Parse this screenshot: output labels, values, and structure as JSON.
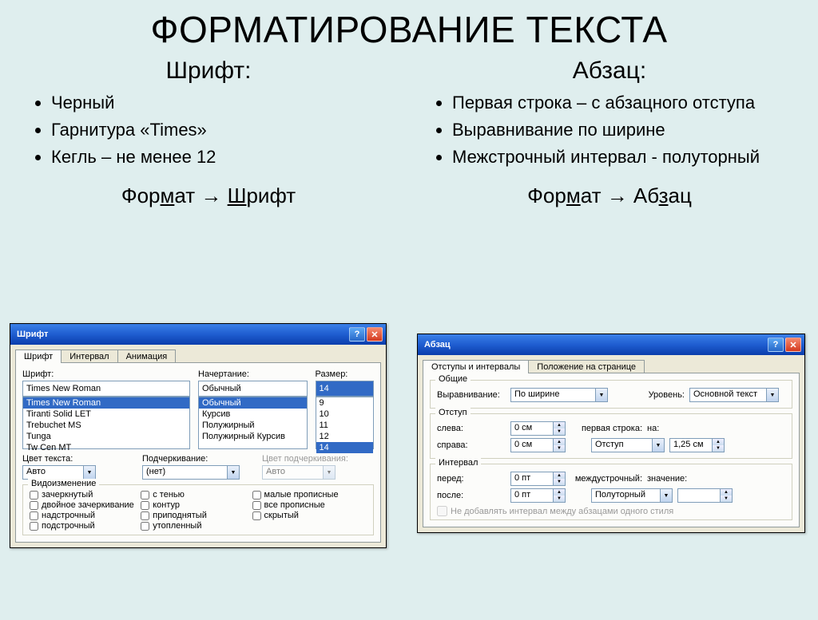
{
  "title": "ФОРМАТИРОВАНИЕ ТЕКСТА",
  "left": {
    "heading": "Шрифт:",
    "bullets": [
      "Черный",
      "Гарнитура «Times»",
      "Кегль – не менее 12"
    ],
    "path_pre": "Фор",
    "path_mid_ul": "м",
    "path_mid": "ат → ",
    "path_tail_ul": "Ш",
    "path_tail": "рифт"
  },
  "right": {
    "heading": "Абзац:",
    "bullets": [
      "Первая строка – с абзацного отступа",
      "Выравнивание по ширине",
      "Межстрочный интервал - полуторный"
    ],
    "path_pre": "Фор",
    "path_mid_ul": "м",
    "path_mid": "ат → Аб",
    "path_tail_ul": "з",
    "path_tail": "ац"
  },
  "fontDialog": {
    "title": "Шрифт",
    "tabs": [
      "Шрифт",
      "Интервал",
      "Анимация"
    ],
    "labels": {
      "font": "Шрифт:",
      "style": "Начертание:",
      "size": "Размер:"
    },
    "fontValue": "Times New Roman",
    "fontList": [
      "Times New Roman",
      "Tiranti Solid LET",
      "Trebuchet MS",
      "Tunga",
      "Tw Cen MT"
    ],
    "styleValue": "Обычный",
    "styleList": [
      "Обычный",
      "Курсив",
      "Полужирный",
      "Полужирный Курсив"
    ],
    "sizeValue": "14",
    "sizeList": [
      "9",
      "10",
      "11",
      "12",
      "14"
    ],
    "colorLabel": "Цвет текста:",
    "colorValue": "Авто",
    "underlineLabel": "Подчеркивание:",
    "underlineValue": "(нет)",
    "underlineColorLabel": "Цвет подчеркивания:",
    "underlineColorValue": "Авто",
    "effectsLabel": "Видоизменение",
    "effects": [
      "зачеркнутый",
      "с тенью",
      "малые прописные",
      "двойное зачеркивание",
      "контур",
      "все прописные",
      "надстрочный",
      "приподнятый",
      "скрытый",
      "подстрочный",
      "утопленный"
    ]
  },
  "paraDialog": {
    "title": "Абзац",
    "tabs": [
      "Отступы и интервалы",
      "Положение на странице"
    ],
    "general": "Общие",
    "alignLabel": "Выравнивание:",
    "alignValue": "По ширине",
    "levelLabel": "Уровень:",
    "levelValue": "Основной текст",
    "indentGroup": "Отступ",
    "leftLabel": "слева:",
    "leftValue": "0 см",
    "rightLabel": "справа:",
    "rightValue": "0 см",
    "firstLineLabel": "первая строка:",
    "firstLineVal": "Отступ",
    "onLabel": "на:",
    "onValue": "1,25 см",
    "spacingGroup": "Интервал",
    "beforeLabel": "перед:",
    "beforeValue": "0 пт",
    "afterLabel": "после:",
    "afterValue": "0 пт",
    "lineSpacingLabel": "междустрочный:",
    "lineSpacingValue": "Полуторный",
    "valueLabel": "значение:",
    "noSpaceSame": "Не добавлять интервал между абзацами одного стиля"
  }
}
